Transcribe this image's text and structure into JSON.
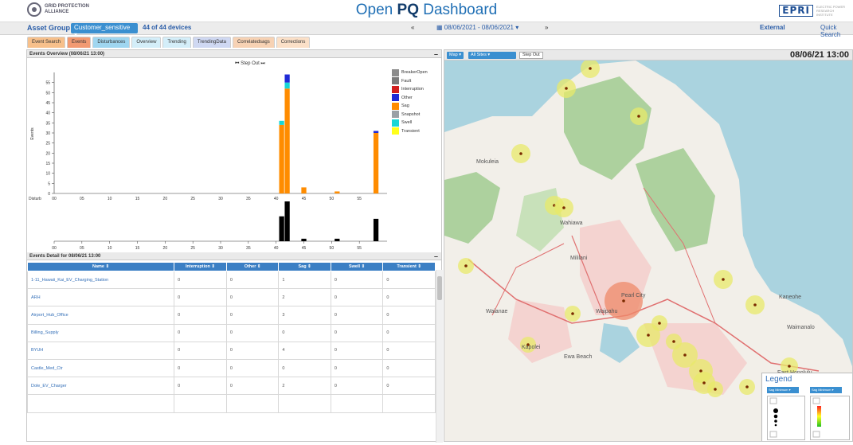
{
  "header": {
    "org_logo_line1": "GRID PROTECTION",
    "org_logo_line2": "ALLIANCE",
    "title_prefix": "Open ",
    "title_bold": "PQ",
    "title_suffix": " Dashboard",
    "partner_logo": "EPRI",
    "partner_sub": "ELECTRIC POWER RESEARCH INSTITUTE"
  },
  "asset_bar": {
    "label": "Asset Group",
    "group_value": "Customer_sensitive ▾",
    "device_count": "44 of 44 devices",
    "prev_icon": "«",
    "date_range": "▦ 08/06/2021 - 08/06/2021 ▾",
    "next_icon": "»",
    "external_label": "External",
    "quick_search_label": "Quick Search"
  },
  "tabs": [
    {
      "label": "Event Search",
      "color": "#f7c08b"
    },
    {
      "label": "Events",
      "color": "#f29a72"
    },
    {
      "label": "Disturbances",
      "color": "#9fd6f0"
    },
    {
      "label": "Overview",
      "color": "#d4eef9"
    },
    {
      "label": "Trending",
      "color": "#d4eef9"
    },
    {
      "label": "TrendingData",
      "color": "#cfd8f2"
    },
    {
      "label": "Correlatedsags",
      "color": "#f7d2b4"
    },
    {
      "label": "Corrections",
      "color": "#fbe0c8"
    }
  ],
  "events_overview": {
    "title": "Events Overview (08/06/21 13:00)",
    "step_out": "⏮ Step Out ⏭",
    "y_axis_label": "Events",
    "strip_label": "Disturb",
    "legend": [
      {
        "label": "BreakerOpen",
        "color": "#8c8c8c"
      },
      {
        "label": "Fault",
        "color": "#7a7a7a"
      },
      {
        "label": "Interruption",
        "color": "#d11f1f"
      },
      {
        "label": "Other",
        "color": "#1f2ad6"
      },
      {
        "label": "Sag",
        "color": "#ff8c00"
      },
      {
        "label": "Snapshot",
        "color": "#9aa0a6"
      },
      {
        "label": "Swell",
        "color": "#17d6d6"
      },
      {
        "label": "Transient",
        "color": "#ffff1a"
      }
    ]
  },
  "chart_data": {
    "type": "bar",
    "x_ticks": [
      "00",
      "05",
      "10",
      "15",
      "20",
      "25",
      "30",
      "35",
      "40",
      "45",
      "50",
      "55"
    ],
    "y_ticks": [
      "0",
      "5",
      "10",
      "15",
      "20",
      "25",
      "30",
      "35",
      "40",
      "45",
      "50",
      "55"
    ],
    "ylim": [
      0,
      60
    ],
    "xlim": [
      0,
      60
    ],
    "legend_position": "right",
    "stacks": [
      {
        "minute": 41,
        "Sag": 34,
        "Swell": 2
      },
      {
        "minute": 42,
        "Sag": 52,
        "Swell": 3,
        "Other": 4
      },
      {
        "minute": 45,
        "Sag": 3
      },
      {
        "minute": 51,
        "Sag": 1
      },
      {
        "minute": 58,
        "Sag": 30,
        "Other": 1
      }
    ],
    "disturbance_strip": [
      {
        "minute": 41,
        "value": 10
      },
      {
        "minute": 42,
        "value": 16
      },
      {
        "minute": 45,
        "value": 1
      },
      {
        "minute": 51,
        "value": 1
      },
      {
        "minute": 58,
        "value": 9
      }
    ]
  },
  "events_detail": {
    "title": "Events Detail for 08/06/21 13:00",
    "columns": [
      "Name ⇕",
      "Interruption ⇕",
      "Other ⇕",
      "Sag ⇕",
      "Swell ⇕",
      "Transient ⇕"
    ],
    "rows": [
      [
        "1-11_Hawaii_Kai_EV_Charging_Station",
        "0",
        "0",
        "1",
        "0",
        "0"
      ],
      [
        "ARH",
        "0",
        "0",
        "2",
        "0",
        "0"
      ],
      [
        "Airport_Hub_Office",
        "0",
        "0",
        "3",
        "0",
        "0"
      ],
      [
        "Billing_Supply",
        "0",
        "0",
        "0",
        "0",
        "0"
      ],
      [
        "BYUH",
        "0",
        "0",
        "4",
        "0",
        "0"
      ],
      [
        "Castle_Med_Ctr",
        "0",
        "0",
        "0",
        "0",
        "0"
      ],
      [
        "Dole_EV_Charger",
        "0",
        "0",
        "2",
        "0",
        "0"
      ]
    ]
  },
  "map": {
    "type_select": "Map ▾",
    "filter_select": "All Sites ▾",
    "step_out": "Step Out",
    "datetime": "08/06/21 13:00",
    "labels": [
      "Mililani",
      "Pearl City",
      "Waipahu",
      "Kapolei",
      "Ewa Beach",
      "East Honolulu",
      "Waianae",
      "Wahiawa",
      "Mokuleia",
      "Kaneohe",
      "Waimanalo"
    ],
    "legend_title": "Legend",
    "legend_select_1": "Sag Minimum ▾",
    "legend_select_2": "Sag Minimum ▾"
  }
}
